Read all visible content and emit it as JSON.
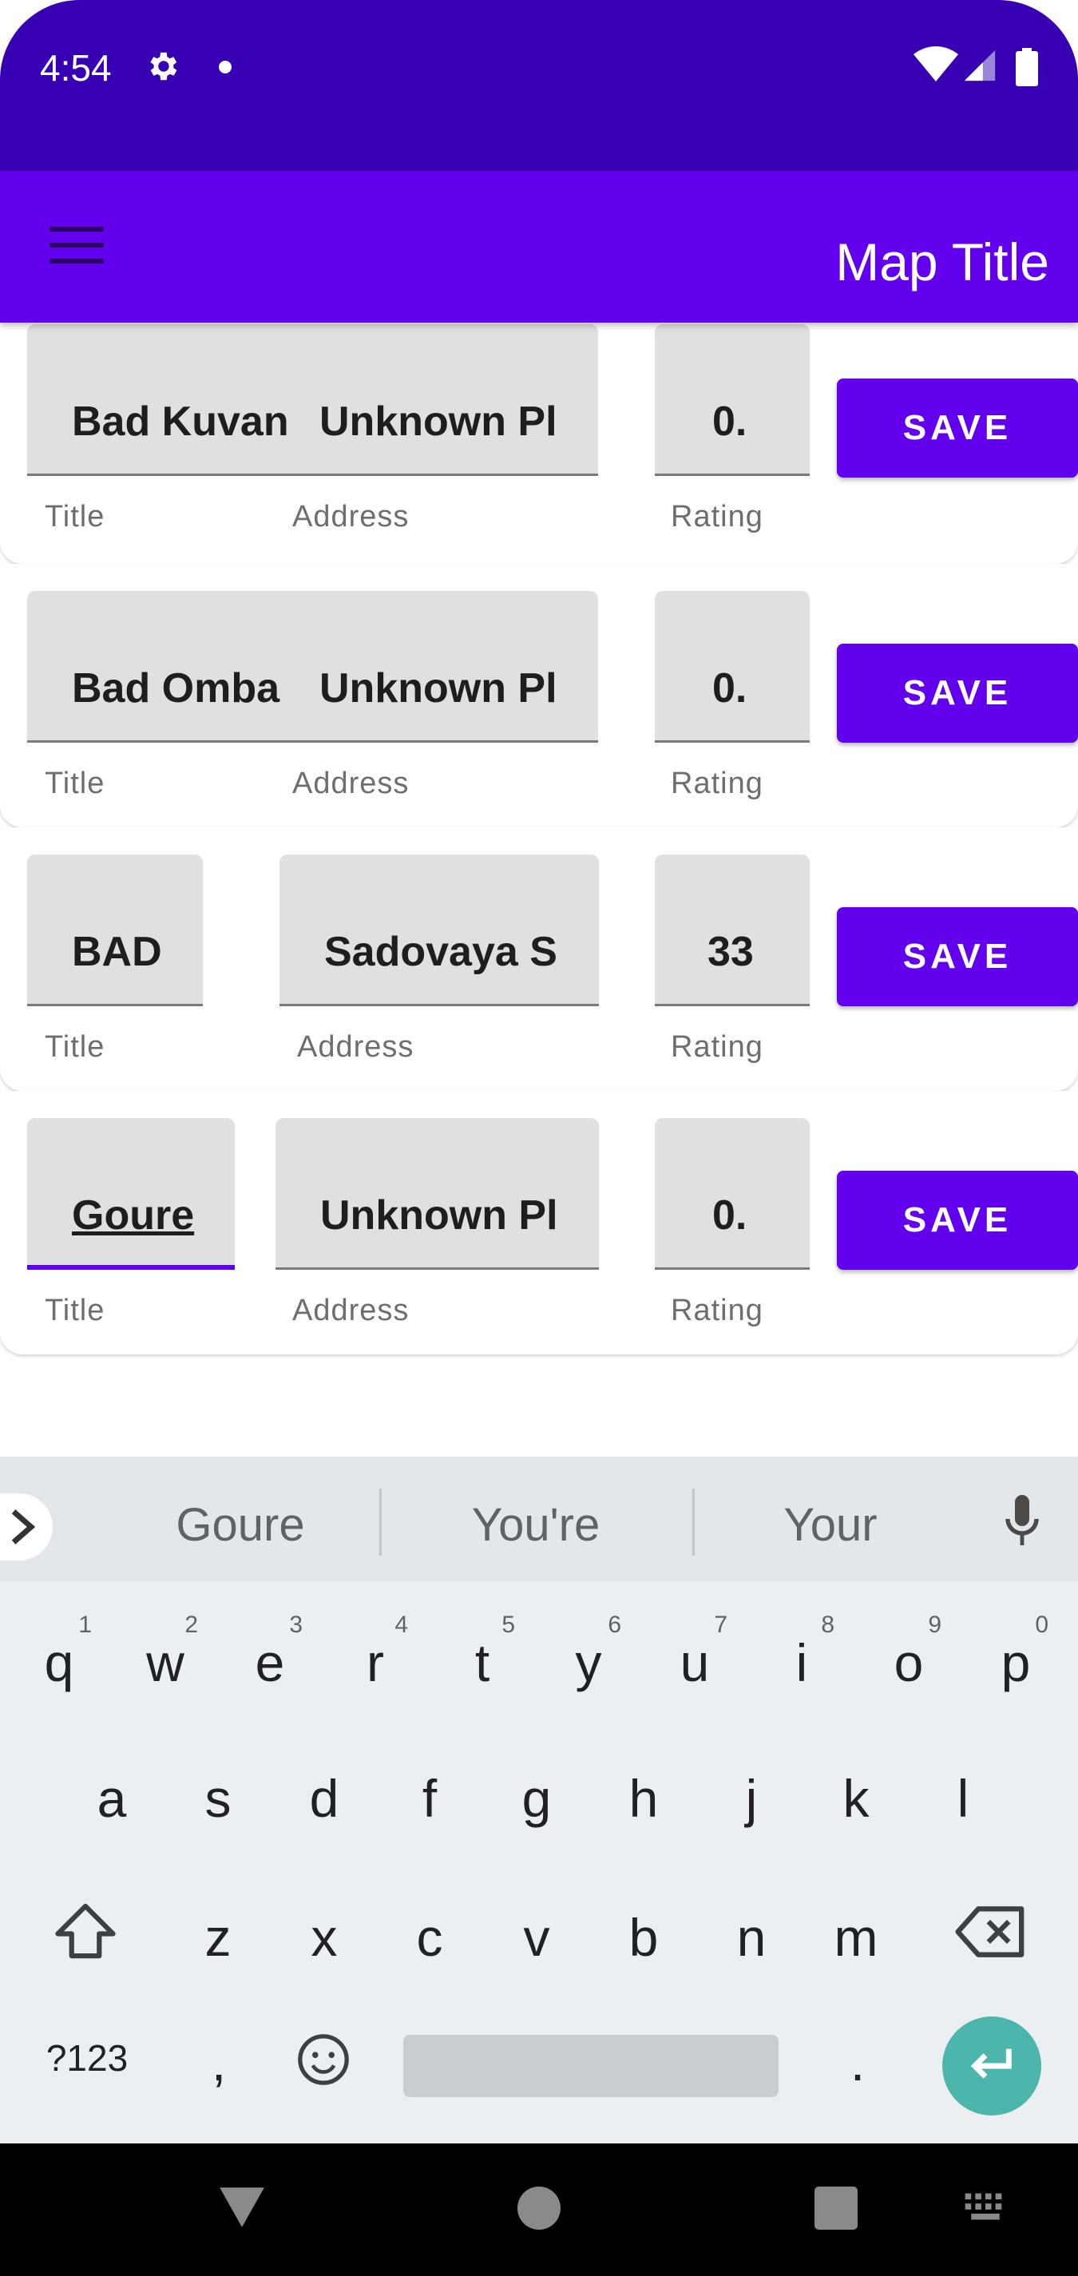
{
  "status_bar": {
    "time": "4:54"
  },
  "app_bar": {
    "title": "Map Title"
  },
  "rows": [
    {
      "title": "Bad Kuvan",
      "address": "Unknown Pl",
      "rating": "0.",
      "title_label": "Title",
      "address_label": "Address",
      "rating_label": "Rating",
      "save_label": "SAVE"
    },
    {
      "title": "Bad Omba",
      "address": "Unknown Pl",
      "rating": "0.",
      "title_label": "Title",
      "address_label": "Address",
      "rating_label": "Rating",
      "save_label": "SAVE"
    },
    {
      "title": "BAD",
      "address": "Sadovaya S",
      "rating": "33",
      "title_label": "Title",
      "address_label": "Address",
      "rating_label": "Rating",
      "save_label": "SAVE"
    },
    {
      "title": "Goure",
      "address": "Unknown Pl",
      "rating": "0.",
      "title_label": "Title",
      "address_label": "Address",
      "rating_label": "Rating",
      "save_label": "SAVE"
    }
  ],
  "keyboard": {
    "suggestions": [
      "Goure",
      "You're",
      "Your"
    ],
    "row1": [
      {
        "ch": "q",
        "hint": "1"
      },
      {
        "ch": "w",
        "hint": "2"
      },
      {
        "ch": "e",
        "hint": "3"
      },
      {
        "ch": "r",
        "hint": "4"
      },
      {
        "ch": "t",
        "hint": "5"
      },
      {
        "ch": "y",
        "hint": "6"
      },
      {
        "ch": "u",
        "hint": "7"
      },
      {
        "ch": "i",
        "hint": "8"
      },
      {
        "ch": "o",
        "hint": "9"
      },
      {
        "ch": "p",
        "hint": "0"
      }
    ],
    "row2": [
      "a",
      "s",
      "d",
      "f",
      "g",
      "h",
      "j",
      "k",
      "l"
    ],
    "row3": [
      "z",
      "x",
      "c",
      "v",
      "b",
      "n",
      "m"
    ],
    "symbols_label": "?123",
    "comma": ",",
    "period": "."
  }
}
